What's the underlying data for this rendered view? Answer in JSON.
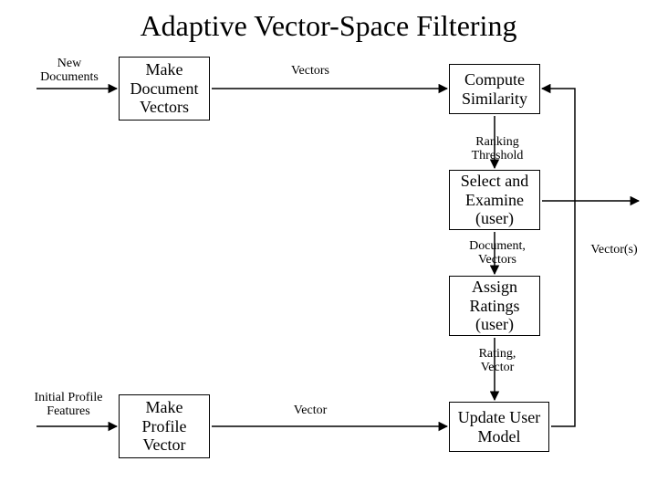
{
  "title": "Adaptive Vector-Space Filtering",
  "inputs": {
    "new_documents": "New\nDocuments",
    "initial_profile_features": "Initial\nProfile Features"
  },
  "nodes": {
    "make_document_vectors": "Make\nDocument\nVectors",
    "compute_similarity": "Compute\nSimilarity",
    "select_examine": "Select and\nExamine\n(user)",
    "assign_ratings": "Assign\nRatings\n(user)",
    "update_user_model": "Update\nUser Model",
    "make_profile_vector": "Make\nProfile\nVector"
  },
  "edges": {
    "vectors": "Vectors",
    "ranking_threshold": "Ranking\nThreshold",
    "document_vectors": "Document,\nVectors",
    "vectors_out": "Vector(s)",
    "rating_vector": "Rating,\nVector",
    "vector": "Vector"
  }
}
